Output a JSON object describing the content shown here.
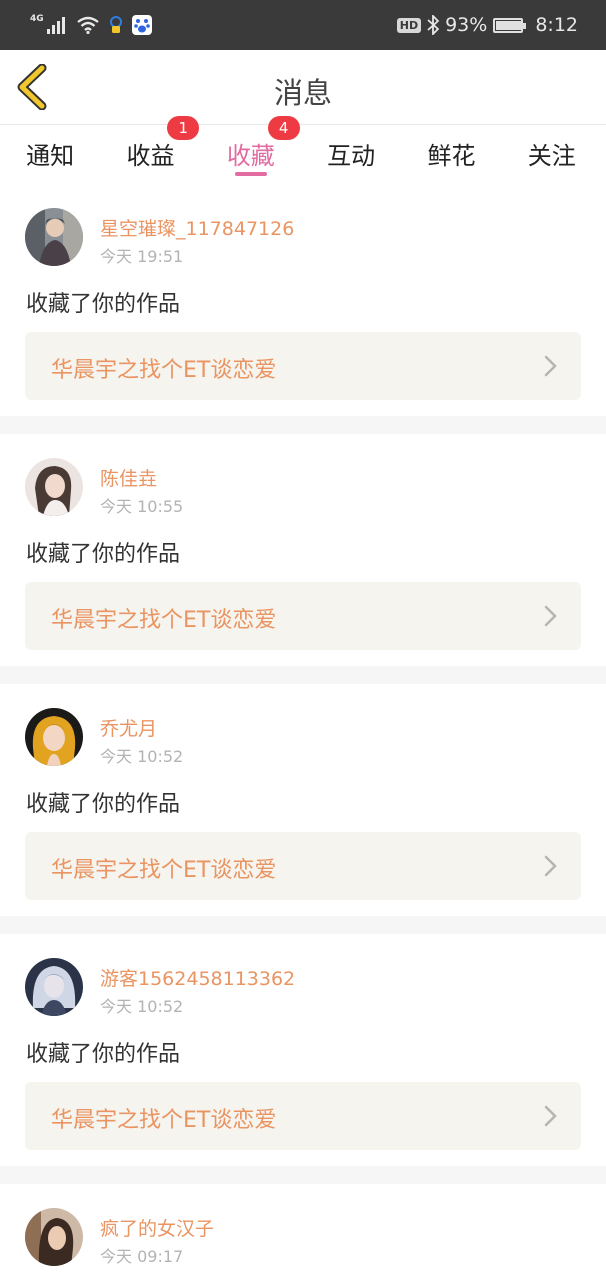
{
  "status_bar": {
    "network": "4G",
    "hd": "HD",
    "battery_text": "93%",
    "battery_level": 0.93,
    "time": "8:12"
  },
  "nav": {
    "title": "消息"
  },
  "tabs": [
    {
      "label": "通知",
      "badge": ""
    },
    {
      "label": "收益",
      "badge": "1"
    },
    {
      "label": "收藏",
      "badge": "4",
      "active": true
    },
    {
      "label": "互动",
      "badge": ""
    },
    {
      "label": "鲜花",
      "badge": ""
    },
    {
      "label": "关注",
      "badge": ""
    }
  ],
  "items": [
    {
      "user": "星空璀璨_117847126",
      "time": "今天 19:51",
      "action": "收藏了你的作品",
      "work": "华晨宇之找个ET谈恋爱"
    },
    {
      "user": "陈佳垚",
      "time": "今天 10:55",
      "action": "收藏了你的作品",
      "work": "华晨宇之找个ET谈恋爱"
    },
    {
      "user": "乔尤月",
      "time": "今天 10:52",
      "action": "收藏了你的作品",
      "work": "华晨宇之找个ET谈恋爱"
    },
    {
      "user": "游客1562458113362",
      "time": "今天 10:52",
      "action": "收藏了你的作品",
      "work": "华晨宇之找个ET谈恋爱"
    },
    {
      "user": "疯了的女汉子",
      "time": "今天 09:17",
      "action": "",
      "work": ""
    }
  ],
  "colors": {
    "accent_pink": "#e26ca1",
    "name_orange": "#ea9462",
    "badge_red": "#ee3b43",
    "back_yellow": "#f2c72b"
  }
}
